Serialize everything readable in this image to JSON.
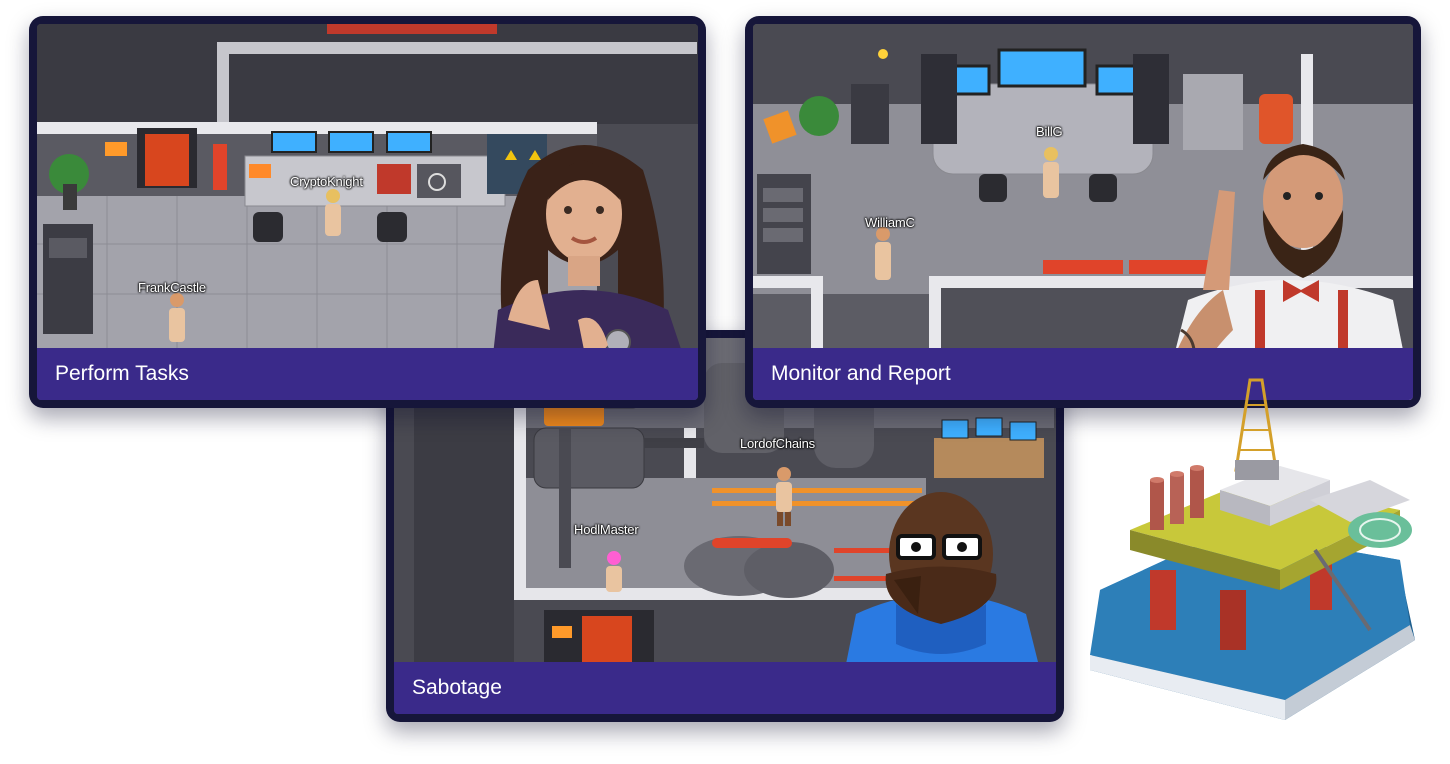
{
  "cards": {
    "tasks": {
      "caption": "Perform Tasks"
    },
    "monitor": {
      "caption": "Monitor and Report"
    },
    "sabotage": {
      "caption": "Sabotage"
    }
  },
  "players": {
    "crypto_knight": "CryptoKnight",
    "frank_castle": "FrankCastle",
    "bill_g": "BillG",
    "william_c": "WilliamC",
    "lord_of_chains": "LordofChains",
    "hodl_master": "HodlMaster"
  },
  "icons": {
    "rig": "oil-rig-icon",
    "portraits": [
      "woman-portrait",
      "bearded-man-portrait",
      "shocked-man-portrait"
    ]
  },
  "colors": {
    "card_frame": "#16163a",
    "caption_bar": "#3a2a8a",
    "floor": "#9b9ba3",
    "wall": "#e4e4e8",
    "accent_red": "#e0442a",
    "screen_blue": "#3fb0ff",
    "water": "#2d7fb8"
  }
}
